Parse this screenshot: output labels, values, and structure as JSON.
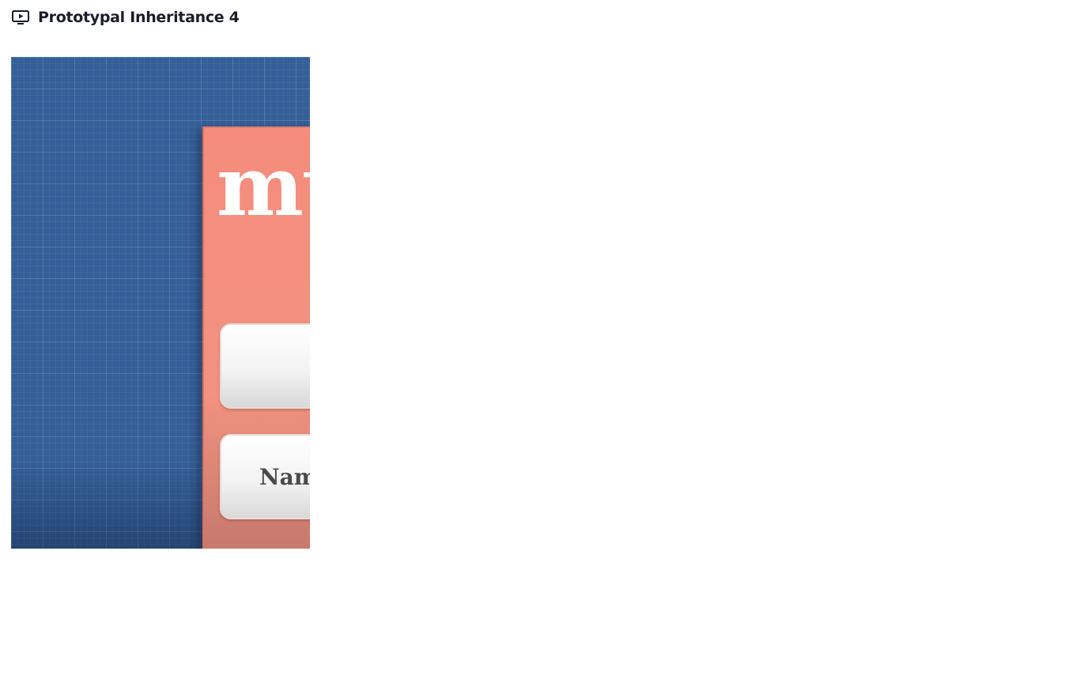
{
  "header": {
    "icon": "video-play-icon",
    "title": "Prototypal Inheritance 4"
  },
  "video": {
    "heading_text": "mu",
    "slots": [
      {
        "text": "("
      },
      {
        "text": "Nam"
      }
    ]
  },
  "colors": {
    "background": "#345f98",
    "card": "#f58c7c",
    "title_text": "#1c1d2b"
  }
}
